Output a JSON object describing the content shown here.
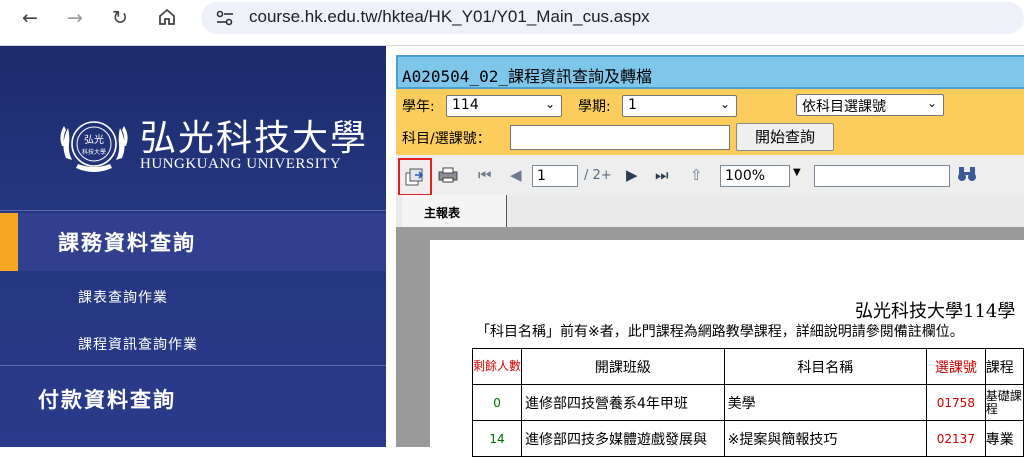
{
  "browser": {
    "url": "course.hk.edu.tw/hktea/HK_Y01/Y01_Main_cus.aspx"
  },
  "sidebar": {
    "logo_cn": "弘光科技大學",
    "logo_en": "HUNGKUANG UNIVERSITY",
    "seal_text_top": "弘光",
    "seal_text_bottom": "科技大學",
    "sections": [
      {
        "title": "課務資料查詢",
        "active": true,
        "items": [
          "課表查詢作業",
          "課程資訊查詢作業"
        ]
      },
      {
        "title": "付款資料查詢",
        "active": false,
        "items": []
      }
    ]
  },
  "panel": {
    "title": "A020504_02_課程資訊查詢及轉檔",
    "query": {
      "year_label": "學年:",
      "year_value": "114",
      "term_label": "學期:",
      "term_value": "1",
      "mode_value": "依科目選課號",
      "subject_label": "科目/選課號：",
      "subject_value": "",
      "search_button": "開始查詢"
    },
    "toolbar": {
      "page_value": "1",
      "page_total": "/ 2+",
      "zoom_value": "100%",
      "find_value": ""
    },
    "tabs": [
      "主報表"
    ]
  },
  "report": {
    "title": "弘光科技大學114學",
    "note": "「科目名稱」前有※者，此門課程為網路教學課程，詳細說明請參閱備註欄位。",
    "headers": {
      "remaining": "剩餘人數",
      "class": "開課班級",
      "course": "科目名稱",
      "code": "選課號",
      "extra": "課程"
    },
    "rows": [
      {
        "remaining": "0",
        "class": "進修部四技營養系4年甲班",
        "course": "美學",
        "code": "01758",
        "extra": "基礎課程"
      },
      {
        "remaining": "14",
        "class": "進修部四技多媒體遊戲發展與",
        "course": "※提案與簡報技巧",
        "code": "02137",
        "extra": "專業"
      }
    ]
  },
  "colors": {
    "sidebar_bg": "#24367f",
    "accent": "#f5a623",
    "title_bar": "#7ec6ea",
    "query_bg": "#fccd5c",
    "highlight_border": "#e02020"
  }
}
